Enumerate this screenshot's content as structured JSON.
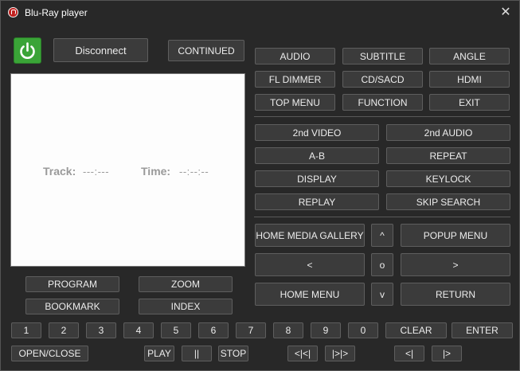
{
  "window": {
    "title": "Blu-Ray player",
    "close_glyph": "✕"
  },
  "connection": {
    "power_icon": "power-icon",
    "disconnect_label": "Disconnect",
    "continued_label": "CONTINUED"
  },
  "display": {
    "track_label": "Track:",
    "track_value": "---:---",
    "time_label": "Time:",
    "time_value": "--:--:--"
  },
  "top_buttons": {
    "audio": "AUDIO",
    "subtitle": "SUBTITLE",
    "angle": "ANGLE",
    "fl_dimmer": "FL DIMMER",
    "cd_sacd": "CD/SACD",
    "hdmi": "HDMI",
    "top_menu": "TOP MENU",
    "function": "FUNCTION",
    "exit": "EXIT"
  },
  "mid_buttons": {
    "second_video": "2nd VIDEO",
    "second_audio": "2nd AUDIO",
    "a_b": "A-B",
    "repeat": "REPEAT",
    "display": "DISPLAY",
    "keylock": "KEYLOCK",
    "replay": "REPLAY",
    "skip_search": "SKIP SEARCH"
  },
  "nav": {
    "home_media_gallery": "HOME MEDIA GALLERY",
    "up": "^",
    "popup_menu": "POPUP MENU",
    "left": "<",
    "ok": "o",
    "right": ">",
    "home_menu": "HOME MENU",
    "down": "v",
    "return": "RETURN"
  },
  "left_buttons": {
    "program": "PROGRAM",
    "zoom": "ZOOM",
    "bookmark": "BOOKMARK",
    "index": "INDEX"
  },
  "numpad": [
    "1",
    "2",
    "3",
    "4",
    "5",
    "6",
    "7",
    "8",
    "9",
    "0"
  ],
  "numpad_actions": {
    "clear": "CLEAR",
    "enter": "ENTER"
  },
  "transport": {
    "open_close": "OPEN/CLOSE",
    "play": "PLAY",
    "pause": "||",
    "stop": "STOP",
    "prev_chapter": "<|<|",
    "next_chapter": "|>|>",
    "step_back": "<|",
    "step_forward": "|>"
  }
}
